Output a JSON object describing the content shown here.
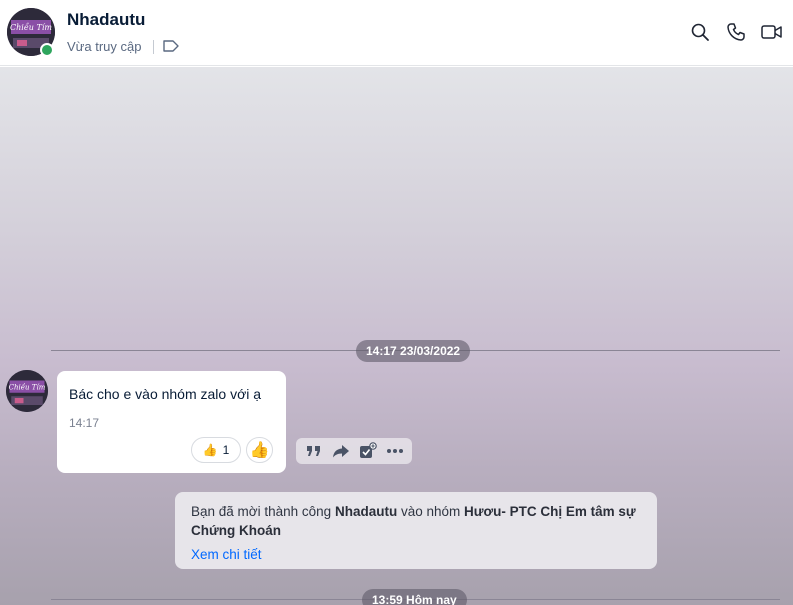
{
  "header": {
    "contact_name": "Nhadautu",
    "status_text": "Vừa truy cập",
    "avatar_icon": "contact-avatar-image",
    "online_color": "#2ea55d",
    "actions": [
      "search-icon",
      "phone-icon",
      "video-call-icon"
    ]
  },
  "chat": {
    "separators": [
      {
        "label": "14:17 23/03/2022"
      },
      {
        "label": "13:59 Hôm nay"
      }
    ],
    "message": {
      "text": "Bác cho e vào nhóm zalo với ạ",
      "time": "14:17",
      "reaction_emoji": "👍",
      "reaction_count": "1",
      "add_reaction_emoji": "👍"
    },
    "message_actions": [
      "quote-icon",
      "forward-icon",
      "add-task-icon",
      "more-icon"
    ],
    "notice": {
      "prefix": "Bạn đã mời thành công ",
      "contact": "Nhadautu",
      "middle": " vào nhóm ",
      "group": "Hươu- PTC Chị Em tâm sự Chứng Khoán",
      "link": "Xem chi tiết"
    }
  },
  "colors": {
    "accent": "#0068ff",
    "bubble": "#ffffff"
  }
}
